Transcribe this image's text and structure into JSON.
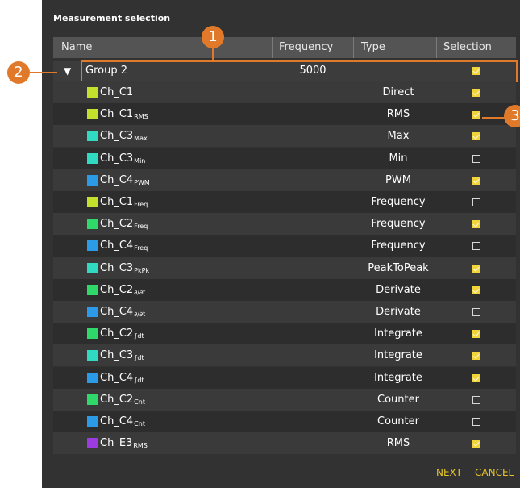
{
  "dialog": {
    "title": "Measurement selection"
  },
  "columns": {
    "name": "Name",
    "frequency": "Frequency",
    "type": "Type",
    "selection": "Selection"
  },
  "group": {
    "expand_glyph": "▼",
    "name": "Group 2",
    "frequency": "5000",
    "selected": true
  },
  "channels": [
    {
      "base": "Ch_C1",
      "sub": "",
      "type": "Direct",
      "selected": true,
      "color": "#c3e02c"
    },
    {
      "base": "Ch_C1",
      "sub": "RMS",
      "type": "RMS",
      "selected": true,
      "color": "#c3e02c"
    },
    {
      "base": "Ch_C3",
      "sub": "Max",
      "type": "Max",
      "selected": true,
      "color": "#2fd9c2"
    },
    {
      "base": "Ch_C3",
      "sub": "Min",
      "type": "Min",
      "selected": false,
      "color": "#2fd9c2"
    },
    {
      "base": "Ch_C4",
      "sub": "PWM",
      "type": "PWM",
      "selected": true,
      "color": "#2b9be8"
    },
    {
      "base": "Ch_C1",
      "sub": "Freq",
      "type": "Frequency",
      "selected": false,
      "color": "#c3e02c"
    },
    {
      "base": "Ch_C2",
      "sub": "Freq",
      "type": "Frequency",
      "selected": true,
      "color": "#2ed96a"
    },
    {
      "base": "Ch_C4",
      "sub": "Freq",
      "type": "Frequency",
      "selected": false,
      "color": "#2b9be8"
    },
    {
      "base": "Ch_C3",
      "sub": "PkPk",
      "type": "PeakToPeak",
      "selected": true,
      "color": "#2fd9c2"
    },
    {
      "base": "Ch_C2",
      "sub": "∂/∂t",
      "type": "Derivate",
      "selected": true,
      "color": "#2ed96a"
    },
    {
      "base": "Ch_C4",
      "sub": "∂/∂t",
      "type": "Derivate",
      "selected": false,
      "color": "#2b9be8"
    },
    {
      "base": "Ch_C2",
      "sub": "∫dt",
      "type": "Integrate",
      "selected": true,
      "color": "#2ed96a"
    },
    {
      "base": "Ch_C3",
      "sub": "∫dt",
      "type": "Integrate",
      "selected": true,
      "color": "#2fd9c2"
    },
    {
      "base": "Ch_C4",
      "sub": "∫dt",
      "type": "Integrate",
      "selected": true,
      "color": "#2b9be8"
    },
    {
      "base": "Ch_C2",
      "sub": "Cnt",
      "type": "Counter",
      "selected": false,
      "color": "#2ed96a"
    },
    {
      "base": "Ch_C4",
      "sub": "Cnt",
      "type": "Counter",
      "selected": false,
      "color": "#2b9be8"
    },
    {
      "base": "Ch_E3",
      "sub": "RMS",
      "type": "RMS",
      "selected": true,
      "color": "#9b3ce0"
    }
  ],
  "callouts": {
    "one": "1",
    "two": "2",
    "three": "3"
  },
  "footer": {
    "next_label": "NEXT",
    "cancel_label": "CANCEL"
  },
  "colors": {
    "accent": "#e07a2a",
    "checkbox_on": "#f0d43a",
    "footer_text": "#e8c528"
  }
}
